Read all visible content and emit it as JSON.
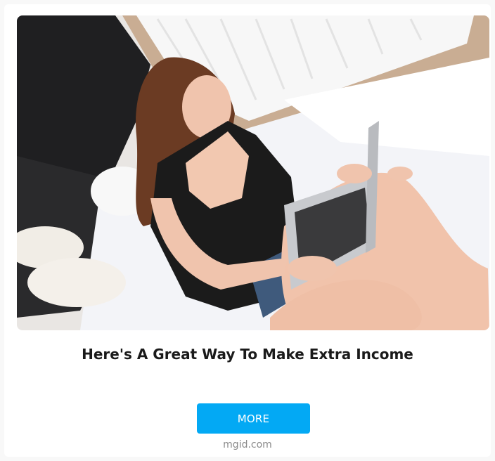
{
  "ad": {
    "image": {
      "alt_semantic": "ad-photo",
      "colors": {
        "wall": "#ece9e6",
        "curtain": "#f6f6f6",
        "bedsheet": "#f2f3f7",
        "dark_fabric": "#1d1d1f",
        "shirt": "#1b1b1b",
        "skin": "#f0c4ad",
        "hair": "#6a3a22",
        "laptop": "#c9cbcf",
        "floor": "#c9ad93"
      }
    },
    "headline": "Here's A Great Way To Make Extra Income",
    "cta_label": "MORE",
    "source": "mgid.com",
    "cta_color": "#03a9f4"
  }
}
